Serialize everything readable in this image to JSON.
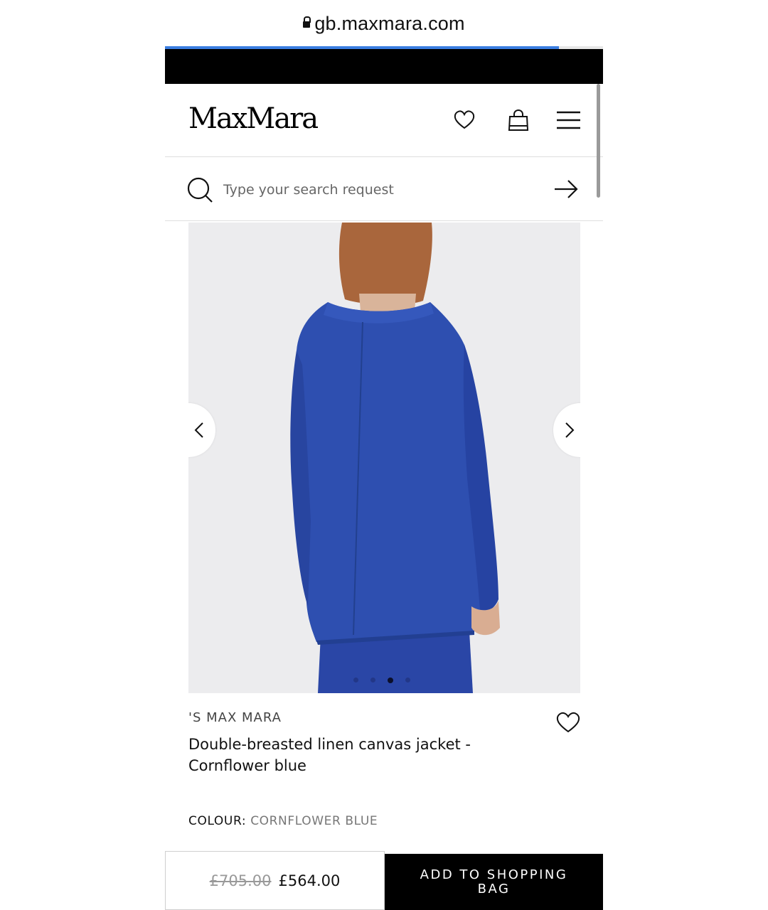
{
  "browser": {
    "url": "gb.maxmara.com",
    "lock_icon": "lock-icon",
    "load_progress": 0.9
  },
  "header": {
    "logo": "MaxMara",
    "icons": [
      "heart-icon",
      "shopping-bag-icon",
      "hamburger-menu-icon"
    ]
  },
  "search": {
    "placeholder": "Type your search request",
    "icons": [
      "search-icon",
      "arrow-right-icon"
    ]
  },
  "gallery": {
    "slide_count": 4,
    "active_slide": 3,
    "icons": [
      "chevron-left-icon",
      "chevron-right-icon"
    ],
    "jacket_color": "#2e4fb0"
  },
  "product": {
    "brand": "'S MAX MARA",
    "title": "Double-breasted linen canvas jacket - Cornflower blue",
    "colour_label": "COLOUR:",
    "colour_value": "CORNFLOWER BLUE"
  },
  "purchase": {
    "old_price": "£705.00",
    "price": "£564.00",
    "add_button": "ADD TO SHOPPING BAG"
  },
  "colors": {
    "accent": "#3b7de0",
    "primary_button": "#000000"
  }
}
